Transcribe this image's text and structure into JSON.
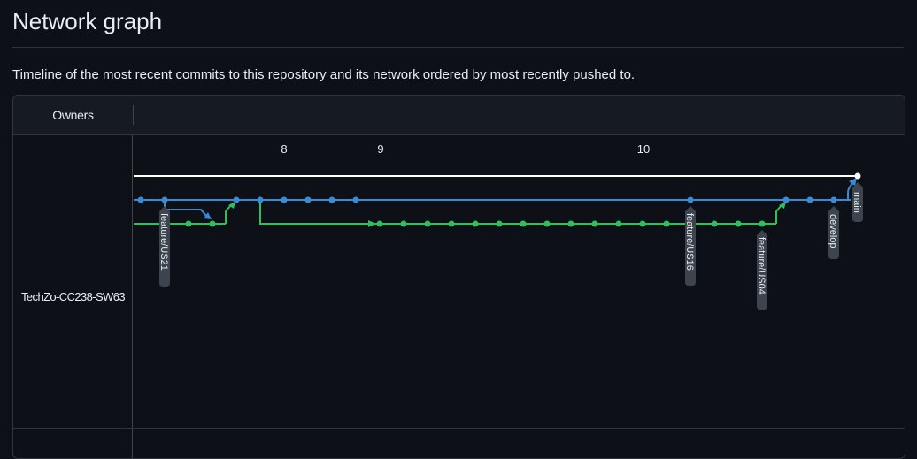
{
  "page": {
    "title": "Network graph",
    "description": "Timeline of the most recent commits to this repository and its network ordered by most recently pushed to."
  },
  "graph": {
    "owners_header": "Owners",
    "owner": "TechZo-CC238-SW63",
    "dates": [
      "8",
      "9",
      "10"
    ],
    "branches": [
      "feature/US21",
      "feature/US16",
      "feature/US04",
      "develop",
      "main"
    ],
    "colors": {
      "main": "#ffffff",
      "develop": "#3a8bd6",
      "feature": "#2fbf5d",
      "label_bg": "#3d444d",
      "background": "#0d1117"
    }
  }
}
